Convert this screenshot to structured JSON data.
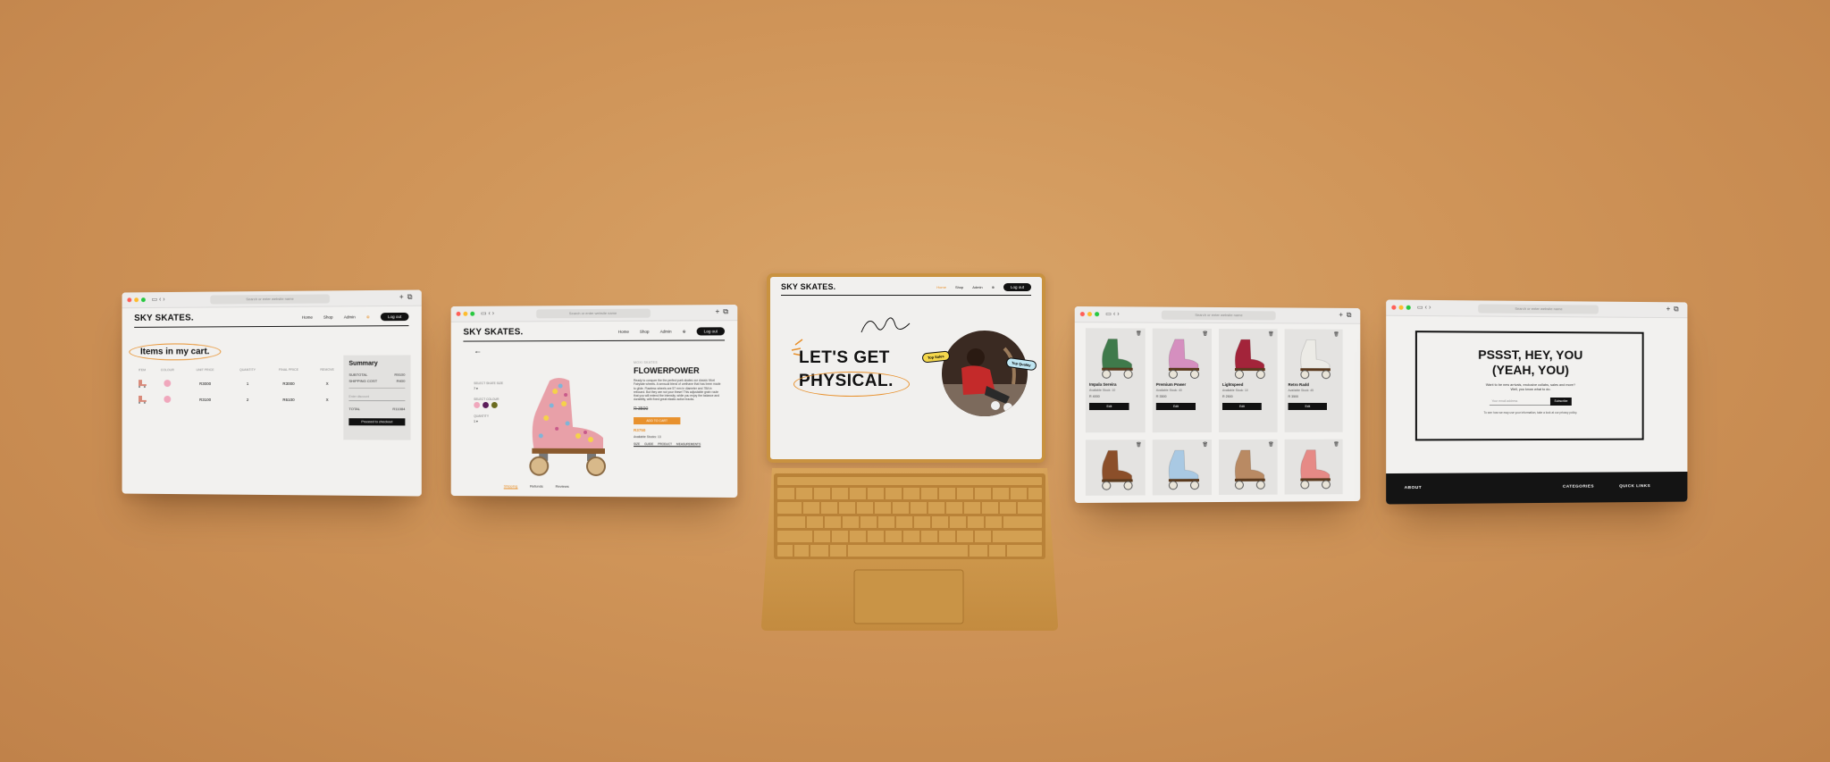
{
  "browser": {
    "url_placeholder": "Search or enter website name"
  },
  "brand": "SKY SKATES.",
  "nav": {
    "home": "Home",
    "shop": "Shop",
    "admin": "Admin",
    "login": "Log out"
  },
  "cart": {
    "title": "Items in my cart.",
    "columns": [
      "ITEM",
      "COLOUR",
      "UNIT PRICE",
      "QUANTITY",
      "FINAL PRICE",
      "REMOVE"
    ],
    "rows": [
      {
        "unit_price": "R3000",
        "quantity": "1",
        "final_price": "R3000",
        "remove": "X"
      },
      {
        "unit_price": "R3100",
        "quantity": "2",
        "final_price": "R6100",
        "remove": "X"
      }
    ],
    "summary": {
      "title": "Summary",
      "subtotal_label": "SUBTOTAL",
      "subtotal": "R9100",
      "shipping_label": "SHIPPING COST",
      "shipping": "R400",
      "promo_placeholder": "Enter discount",
      "total_label": "TOTAL",
      "total": "R11084",
      "button": "Proceed to checkout"
    }
  },
  "product": {
    "select_size_label": "SELECT SKATE SIZE",
    "select_colour_label": "SELECT COLOUR",
    "quantity_label": "QUANTITY",
    "size_value": "7",
    "qty_value": "1",
    "colors": [
      "#f0a7bc",
      "#5b1e5a",
      "#6b6b1f"
    ],
    "tag": "MOXI SKATES",
    "name": "FLOWERPOWER",
    "description": "Ready to conquer the the perfect park skates our classic Moxi Fairytale wheels. A sensual blend of urethane that has been made to glide. Flawless wheels are 57 mm in diameter and 78A in rebound. But they are not your these! This adjustable grain route that you will extend the intensity, while you enjoy the balance and durability, with fixed great elastic action tracks.",
    "old_price": "R 3500",
    "cart_button": "ADD TO CART",
    "price": "R3750",
    "stock": "Available Stocks: 13",
    "links": "SIZE GUIDE   PRODUCT MEASUREMENTS",
    "tabs": [
      "Shipping",
      "Refunds",
      "Reviews"
    ]
  },
  "hero": {
    "line1": "LET'S GET",
    "line2": "PHYSICAL.",
    "pill1": "Top Sales",
    "pill2": "Top Quality"
  },
  "shop": {
    "items": [
      {
        "name": "Impala Sereira",
        "stock": "Available Stock: 10",
        "price": "R 4000",
        "button": "Edit",
        "color": "#3f7a4b"
      },
      {
        "name": "Premium Power",
        "stock": "Available Stock: 40",
        "price": "R 3500",
        "button": "Edit",
        "color": "#d58fbf"
      },
      {
        "name": "Lightspeed",
        "stock": "Available Stock: 10",
        "price": "R 2500",
        "button": "Edit",
        "color": "#a3243a"
      },
      {
        "name": "Retro Radd",
        "stock": "Available Stock: 45",
        "price": "R 3500",
        "button": "Edit",
        "color": "#ecebe6"
      },
      {
        "name": "",
        "color": "#8b4f2a"
      },
      {
        "name": "",
        "color": "#a9c9e3"
      },
      {
        "name": "",
        "color": "#b98a63"
      },
      {
        "name": "",
        "color": "#e68a86"
      }
    ]
  },
  "news": {
    "title_line1": "PSSST, HEY, YOU",
    "title_line2": "(YEAH, YOU)",
    "subtitle_line1": "Want to be new arrivals, exclusive collabs, sales and more?",
    "subtitle_line2": "Well, you know what to do.",
    "input_placeholder": "Your email address",
    "button": "Subscribe",
    "note": "To see how we may use your information, take a look at our privacy policy.",
    "footer": {
      "about": "ABOUT",
      "categories": "CATEGORIES",
      "links": "QUICK LINKS"
    }
  },
  "colors": {
    "accent": "#e8912d",
    "dark": "#111111",
    "background": "#cf9458"
  }
}
